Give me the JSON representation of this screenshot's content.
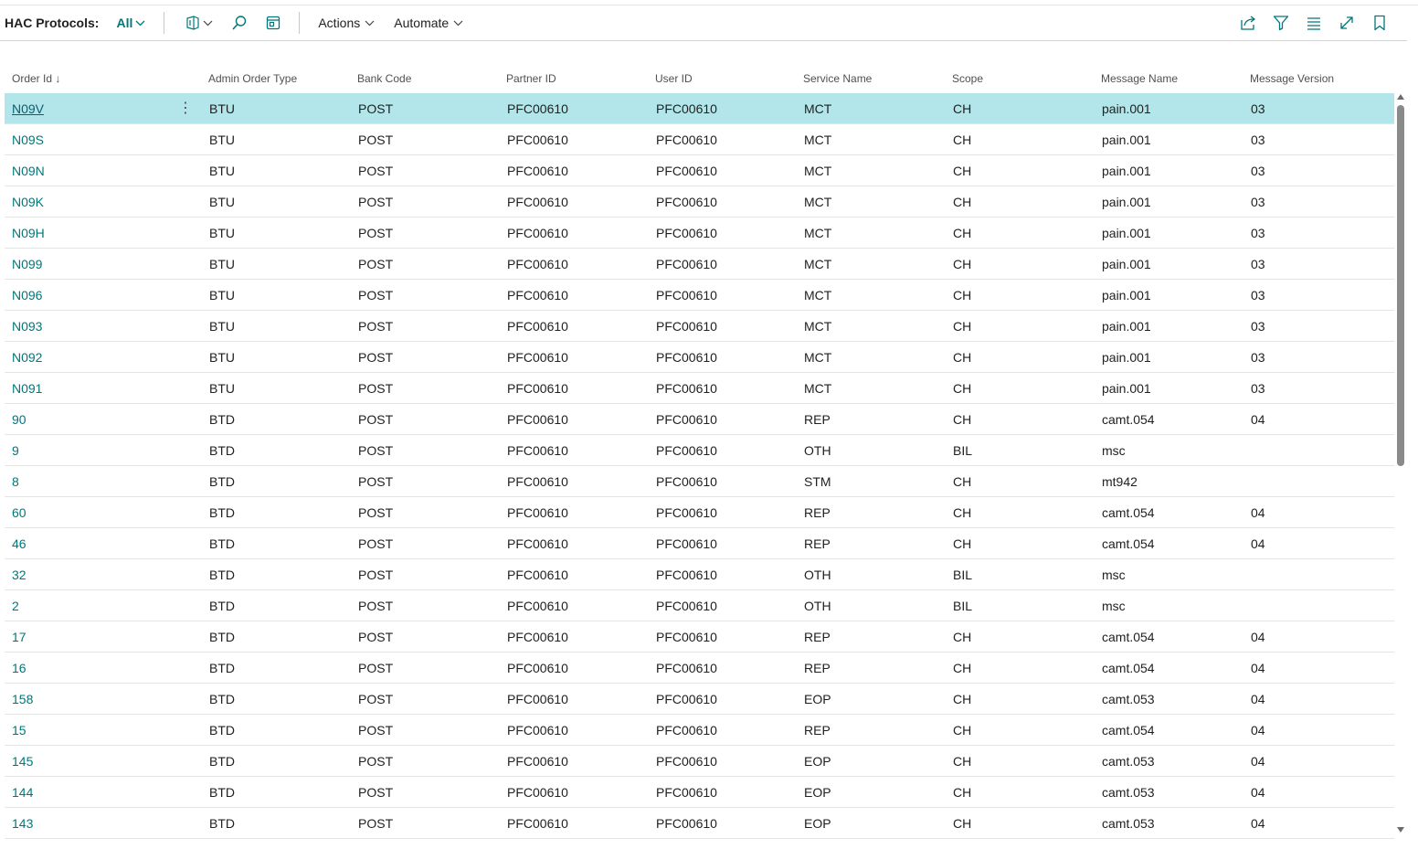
{
  "page": {
    "title": "HAC Protocols:",
    "view_filter": "All",
    "actions_label": "Actions",
    "automate_label": "Automate"
  },
  "icons": {
    "analyze": "analyze-icon",
    "search": "search-icon",
    "edit_list": "edit-list-icon",
    "share": "share-icon",
    "filter": "filter-icon",
    "list_view": "list-view-icon",
    "expand": "expand-icon",
    "bookmark": "bookmark-icon"
  },
  "colors": {
    "accent": "#00787a",
    "selected_row": "#b3e6ea"
  },
  "table": {
    "sort_indicator": "↓",
    "columns": [
      "Order Id",
      "Admin Order Type",
      "Bank Code",
      "Partner ID",
      "User ID",
      "Service Name",
      "Scope",
      "Message Name",
      "Message Version"
    ],
    "rows": [
      {
        "order_id": "N09V",
        "admin_order_type": "BTU",
        "bank_code": "POST",
        "partner_id": "PFC00610",
        "user_id": "PFC00610",
        "service_name": "MCT",
        "scope": "CH",
        "message_name": "pain.001",
        "message_version": "03"
      },
      {
        "order_id": "N09S",
        "admin_order_type": "BTU",
        "bank_code": "POST",
        "partner_id": "PFC00610",
        "user_id": "PFC00610",
        "service_name": "MCT",
        "scope": "CH",
        "message_name": "pain.001",
        "message_version": "03"
      },
      {
        "order_id": "N09N",
        "admin_order_type": "BTU",
        "bank_code": "POST",
        "partner_id": "PFC00610",
        "user_id": "PFC00610",
        "service_name": "MCT",
        "scope": "CH",
        "message_name": "pain.001",
        "message_version": "03"
      },
      {
        "order_id": "N09K",
        "admin_order_type": "BTU",
        "bank_code": "POST",
        "partner_id": "PFC00610",
        "user_id": "PFC00610",
        "service_name": "MCT",
        "scope": "CH",
        "message_name": "pain.001",
        "message_version": "03"
      },
      {
        "order_id": "N09H",
        "admin_order_type": "BTU",
        "bank_code": "POST",
        "partner_id": "PFC00610",
        "user_id": "PFC00610",
        "service_name": "MCT",
        "scope": "CH",
        "message_name": "pain.001",
        "message_version": "03"
      },
      {
        "order_id": "N099",
        "admin_order_type": "BTU",
        "bank_code": "POST",
        "partner_id": "PFC00610",
        "user_id": "PFC00610",
        "service_name": "MCT",
        "scope": "CH",
        "message_name": "pain.001",
        "message_version": "03"
      },
      {
        "order_id": "N096",
        "admin_order_type": "BTU",
        "bank_code": "POST",
        "partner_id": "PFC00610",
        "user_id": "PFC00610",
        "service_name": "MCT",
        "scope": "CH",
        "message_name": "pain.001",
        "message_version": "03"
      },
      {
        "order_id": "N093",
        "admin_order_type": "BTU",
        "bank_code": "POST",
        "partner_id": "PFC00610",
        "user_id": "PFC00610",
        "service_name": "MCT",
        "scope": "CH",
        "message_name": "pain.001",
        "message_version": "03"
      },
      {
        "order_id": "N092",
        "admin_order_type": "BTU",
        "bank_code": "POST",
        "partner_id": "PFC00610",
        "user_id": "PFC00610",
        "service_name": "MCT",
        "scope": "CH",
        "message_name": "pain.001",
        "message_version": "03"
      },
      {
        "order_id": "N091",
        "admin_order_type": "BTU",
        "bank_code": "POST",
        "partner_id": "PFC00610",
        "user_id": "PFC00610",
        "service_name": "MCT",
        "scope": "CH",
        "message_name": "pain.001",
        "message_version": "03"
      },
      {
        "order_id": "90",
        "admin_order_type": "BTD",
        "bank_code": "POST",
        "partner_id": "PFC00610",
        "user_id": "PFC00610",
        "service_name": "REP",
        "scope": "CH",
        "message_name": "camt.054",
        "message_version": "04"
      },
      {
        "order_id": "9",
        "admin_order_type": "BTD",
        "bank_code": "POST",
        "partner_id": "PFC00610",
        "user_id": "PFC00610",
        "service_name": "OTH",
        "scope": "BIL",
        "message_name": "msc",
        "message_version": ""
      },
      {
        "order_id": "8",
        "admin_order_type": "BTD",
        "bank_code": "POST",
        "partner_id": "PFC00610",
        "user_id": "PFC00610",
        "service_name": "STM",
        "scope": "CH",
        "message_name": "mt942",
        "message_version": ""
      },
      {
        "order_id": "60",
        "admin_order_type": "BTD",
        "bank_code": "POST",
        "partner_id": "PFC00610",
        "user_id": "PFC00610",
        "service_name": "REP",
        "scope": "CH",
        "message_name": "camt.054",
        "message_version": "04"
      },
      {
        "order_id": "46",
        "admin_order_type": "BTD",
        "bank_code": "POST",
        "partner_id": "PFC00610",
        "user_id": "PFC00610",
        "service_name": "REP",
        "scope": "CH",
        "message_name": "camt.054",
        "message_version": "04"
      },
      {
        "order_id": "32",
        "admin_order_type": "BTD",
        "bank_code": "POST",
        "partner_id": "PFC00610",
        "user_id": "PFC00610",
        "service_name": "OTH",
        "scope": "BIL",
        "message_name": "msc",
        "message_version": ""
      },
      {
        "order_id": "2",
        "admin_order_type": "BTD",
        "bank_code": "POST",
        "partner_id": "PFC00610",
        "user_id": "PFC00610",
        "service_name": "OTH",
        "scope": "BIL",
        "message_name": "msc",
        "message_version": ""
      },
      {
        "order_id": "17",
        "admin_order_type": "BTD",
        "bank_code": "POST",
        "partner_id": "PFC00610",
        "user_id": "PFC00610",
        "service_name": "REP",
        "scope": "CH",
        "message_name": "camt.054",
        "message_version": "04"
      },
      {
        "order_id": "16",
        "admin_order_type": "BTD",
        "bank_code": "POST",
        "partner_id": "PFC00610",
        "user_id": "PFC00610",
        "service_name": "REP",
        "scope": "CH",
        "message_name": "camt.054",
        "message_version": "04"
      },
      {
        "order_id": "158",
        "admin_order_type": "BTD",
        "bank_code": "POST",
        "partner_id": "PFC00610",
        "user_id": "PFC00610",
        "service_name": "EOP",
        "scope": "CH",
        "message_name": "camt.053",
        "message_version": "04"
      },
      {
        "order_id": "15",
        "admin_order_type": "BTD",
        "bank_code": "POST",
        "partner_id": "PFC00610",
        "user_id": "PFC00610",
        "service_name": "REP",
        "scope": "CH",
        "message_name": "camt.054",
        "message_version": "04"
      },
      {
        "order_id": "145",
        "admin_order_type": "BTD",
        "bank_code": "POST",
        "partner_id": "PFC00610",
        "user_id": "PFC00610",
        "service_name": "EOP",
        "scope": "CH",
        "message_name": "camt.053",
        "message_version": "04"
      },
      {
        "order_id": "144",
        "admin_order_type": "BTD",
        "bank_code": "POST",
        "partner_id": "PFC00610",
        "user_id": "PFC00610",
        "service_name": "EOP",
        "scope": "CH",
        "message_name": "camt.053",
        "message_version": "04"
      },
      {
        "order_id": "143",
        "admin_order_type": "BTD",
        "bank_code": "POST",
        "partner_id": "PFC00610",
        "user_id": "PFC00610",
        "service_name": "EOP",
        "scope": "CH",
        "message_name": "camt.053",
        "message_version": "04"
      }
    ]
  }
}
